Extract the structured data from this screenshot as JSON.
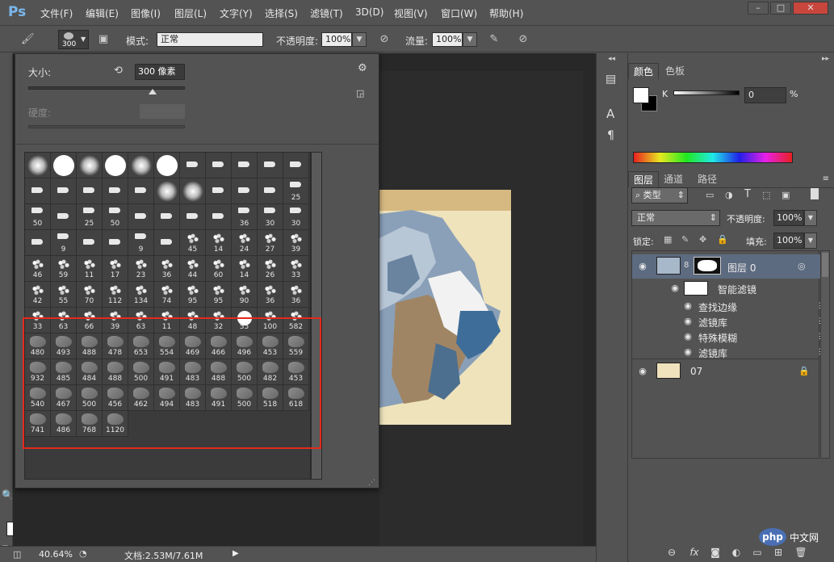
{
  "app": {
    "logo": "Ps"
  },
  "menu": [
    "文件(F)",
    "编辑(E)",
    "图像(I)",
    "图层(L)",
    "文字(Y)",
    "选择(S)",
    "滤镜(T)",
    "3D(D)",
    "视图(V)",
    "窗口(W)",
    "帮助(H)"
  ],
  "window_controls": {
    "minimize": "–",
    "restore": "□",
    "close": "✕"
  },
  "options": {
    "brush_size": "300",
    "mode_label": "模式:",
    "mode_value": "正常",
    "opacity_label": "不透明度:",
    "opacity_value": "100%",
    "flow_label": "流量:",
    "flow_value": "100%"
  },
  "picker": {
    "size_label": "大小:",
    "size_value": "300 像素",
    "hardness_label": "硬度:",
    "hardness_value": "",
    "size_slider_fraction": 0.79,
    "brushes": [
      {
        "n": "",
        "k": "soft"
      },
      {
        "n": "",
        "k": "hard"
      },
      {
        "n": "",
        "k": "soft"
      },
      {
        "n": "",
        "k": "hard"
      },
      {
        "n": "",
        "k": "soft"
      },
      {
        "n": "",
        "k": "hard"
      },
      {
        "n": "",
        "k": "tip"
      },
      {
        "n": "",
        "k": "tip"
      },
      {
        "n": "",
        "k": "tip"
      },
      {
        "n": "",
        "k": "tip"
      },
      {
        "n": "",
        "k": "tip"
      },
      {
        "n": "",
        "k": "tip"
      },
      {
        "n": "",
        "k": "tip"
      },
      {
        "n": "",
        "k": "tip"
      },
      {
        "n": "",
        "k": "tip"
      },
      {
        "n": "",
        "k": "tip"
      },
      {
        "n": "",
        "k": "soft"
      },
      {
        "n": "",
        "k": "soft"
      },
      {
        "n": "",
        "k": "tip"
      },
      {
        "n": "",
        "k": "tip"
      },
      {
        "n": "",
        "k": "tip"
      },
      {
        "n": "25",
        "k": "tip"
      },
      {
        "n": "50",
        "k": "tip"
      },
      {
        "n": "",
        "k": "tip"
      },
      {
        "n": "25",
        "k": "tip"
      },
      {
        "n": "50",
        "k": "tip"
      },
      {
        "n": "",
        "k": "tip"
      },
      {
        "n": "",
        "k": "tip"
      },
      {
        "n": "",
        "k": "tip"
      },
      {
        "n": "",
        "k": "tip"
      },
      {
        "n": "36",
        "k": "tip"
      },
      {
        "n": "30",
        "k": "tip"
      },
      {
        "n": "30",
        "k": "tip"
      },
      {
        "n": "",
        "k": "tip"
      },
      {
        "n": "9",
        "k": "tip"
      },
      {
        "n": "",
        "k": "tip"
      },
      {
        "n": "",
        "k": "tip"
      },
      {
        "n": "9",
        "k": "tip"
      },
      {
        "n": "",
        "k": "tip"
      },
      {
        "n": "45",
        "k": "splat"
      },
      {
        "n": "14",
        "k": "splat"
      },
      {
        "n": "24",
        "k": "splat"
      },
      {
        "n": "27",
        "k": "splat"
      },
      {
        "n": "39",
        "k": "splat"
      },
      {
        "n": "46",
        "k": "splat"
      },
      {
        "n": "59",
        "k": "splat"
      },
      {
        "n": "11",
        "k": "splat"
      },
      {
        "n": "17",
        "k": "splat"
      },
      {
        "n": "23",
        "k": "splat"
      },
      {
        "n": "36",
        "k": "splat"
      },
      {
        "n": "44",
        "k": "splat"
      },
      {
        "n": "60",
        "k": "splat"
      },
      {
        "n": "14",
        "k": "splat"
      },
      {
        "n": "26",
        "k": "splat"
      },
      {
        "n": "33",
        "k": "splat"
      },
      {
        "n": "42",
        "k": "splat"
      },
      {
        "n": "55",
        "k": "splat"
      },
      {
        "n": "70",
        "k": "splat"
      },
      {
        "n": "112",
        "k": "splat"
      },
      {
        "n": "134",
        "k": "splat"
      },
      {
        "n": "74",
        "k": "splat"
      },
      {
        "n": "95",
        "k": "splat"
      },
      {
        "n": "95",
        "k": "splat"
      },
      {
        "n": "90",
        "k": "splat"
      },
      {
        "n": "36",
        "k": "splat"
      },
      {
        "n": "36",
        "k": "splat"
      },
      {
        "n": "33",
        "k": "splat"
      },
      {
        "n": "63",
        "k": "splat"
      },
      {
        "n": "66",
        "k": "splat"
      },
      {
        "n": "39",
        "k": "splat"
      },
      {
        "n": "63",
        "k": "splat"
      },
      {
        "n": "11",
        "k": "splat"
      },
      {
        "n": "48",
        "k": "splat"
      },
      {
        "n": "32",
        "k": "splat"
      },
      {
        "n": "55",
        "k": "hard"
      },
      {
        "n": "100",
        "k": "splat"
      },
      {
        "n": "582",
        "k": "splat"
      },
      {
        "n": "480",
        "k": "stroke"
      },
      {
        "n": "493",
        "k": "stroke"
      },
      {
        "n": "488",
        "k": "stroke"
      },
      {
        "n": "478",
        "k": "stroke"
      },
      {
        "n": "653",
        "k": "stroke"
      },
      {
        "n": "554",
        "k": "stroke"
      },
      {
        "n": "469",
        "k": "stroke"
      },
      {
        "n": "466",
        "k": "stroke"
      },
      {
        "n": "496",
        "k": "stroke"
      },
      {
        "n": "453",
        "k": "stroke"
      },
      {
        "n": "559",
        "k": "stroke"
      },
      {
        "n": "932",
        "k": "stroke"
      },
      {
        "n": "485",
        "k": "stroke"
      },
      {
        "n": "484",
        "k": "stroke"
      },
      {
        "n": "488",
        "k": "stroke"
      },
      {
        "n": "500",
        "k": "stroke"
      },
      {
        "n": "491",
        "k": "stroke"
      },
      {
        "n": "483",
        "k": "stroke"
      },
      {
        "n": "488",
        "k": "stroke"
      },
      {
        "n": "500",
        "k": "stroke"
      },
      {
        "n": "482",
        "k": "stroke"
      },
      {
        "n": "453",
        "k": "stroke"
      },
      {
        "n": "540",
        "k": "stroke"
      },
      {
        "n": "467",
        "k": "stroke"
      },
      {
        "n": "500",
        "k": "stroke"
      },
      {
        "n": "456",
        "k": "stroke"
      },
      {
        "n": "462",
        "k": "stroke"
      },
      {
        "n": "494",
        "k": "stroke"
      },
      {
        "n": "483",
        "k": "stroke"
      },
      {
        "n": "491",
        "k": "stroke"
      },
      {
        "n": "500",
        "k": "stroke"
      },
      {
        "n": "518",
        "k": "stroke"
      },
      {
        "n": "618",
        "k": "stroke"
      },
      {
        "n": "741",
        "k": "stroke"
      },
      {
        "n": "486",
        "k": "stroke"
      },
      {
        "n": "768",
        "k": "stroke"
      },
      {
        "n": "1120",
        "k": "stroke"
      }
    ]
  },
  "color_panel": {
    "tabs": [
      "颜色",
      "色板"
    ],
    "channel_label": "K",
    "channel_value": "0",
    "unit": "%",
    "colors": {
      "foreground": "#ffffff",
      "background": "#000000"
    }
  },
  "layers_panel": {
    "tabs": [
      "图层",
      "通道",
      "路径"
    ],
    "kind_filter": "类型",
    "blend_mode": "正常",
    "opacity_label": "不透明度:",
    "opacity_value": "100%",
    "lock_label": "锁定:",
    "fill_label": "填充:",
    "fill_value": "100%",
    "layers": [
      {
        "name": "图层 0",
        "selected": true
      },
      {
        "name": "智能滤镜"
      },
      {
        "name": "查找边缘"
      },
      {
        "name": "滤镜库"
      },
      {
        "name": "特殊模糊"
      },
      {
        "name": "滤镜库"
      },
      {
        "name": "07"
      }
    ]
  },
  "status": {
    "zoom": "40.64%",
    "doc_info": "文档:2.53M/7.61M"
  },
  "watermark": {
    "logo": "php",
    "text": "中文网"
  }
}
